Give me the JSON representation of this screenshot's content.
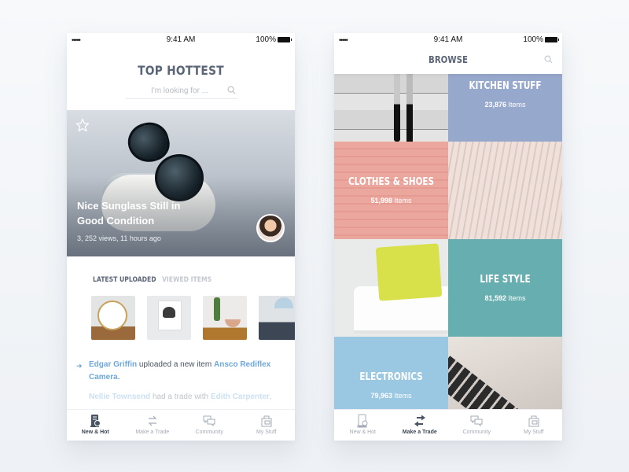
{
  "status_bar": {
    "signal": "•••••",
    "time": "9:41 AM",
    "battery": "100%"
  },
  "left_screen": {
    "title": "TOP HOTTEST",
    "search": {
      "placeholder": "I'm looking for ..."
    },
    "hero": {
      "title": "Nice Sunglass Still in Good Condition",
      "meta": "3, 252 views, 11 hours ago"
    },
    "tabs": [
      {
        "label": "LATEST UPLOADED",
        "active": true
      },
      {
        "label": "VIEWED ITEMS",
        "active": false
      }
    ],
    "thumbnails": [
      "wall-clock",
      "xo-heart-poster",
      "cactus-plants",
      "desk-lamp"
    ],
    "feed": [
      {
        "user": "Edgar Griffin",
        "action": "uploaded a new item",
        "target": "Ansco Rediflex Camera",
        "suffix": "."
      },
      {
        "user": "Nellie Townsend",
        "action": "had a trade with",
        "target": "Edith Carpenter",
        "suffix": "."
      }
    ]
  },
  "right_screen": {
    "title": "BROWSE",
    "categories": [
      {
        "name": "KITCHEN STUFF",
        "count": "23,876",
        "unit": "Items",
        "color": "#97a8cd"
      },
      {
        "name": "CLOTHES & SHOES",
        "count": "51,998",
        "unit": "Items",
        "color": "#eba79e"
      },
      {
        "name": "LIFE STYLE",
        "count": "81,592",
        "unit": "Items",
        "color": "#66aeb0"
      },
      {
        "name": "ELECTRONICS",
        "count": "79,963",
        "unit": "Items",
        "color": "#9ac7e1"
      }
    ]
  },
  "nav": {
    "items": [
      {
        "label": "New & Hot",
        "icon": "new-hot-icon"
      },
      {
        "label": "Make a Trade",
        "icon": "trade-arrows-icon"
      },
      {
        "label": "Community",
        "icon": "chat-bubbles-icon"
      },
      {
        "label": "My Stuff",
        "icon": "bag-icon"
      }
    ],
    "left_active": "New & Hot",
    "right_active": "Make a Trade"
  },
  "colors": {
    "title": "#5a6577",
    "link": "#6ea7de",
    "nav_inactive": "#a4abb6"
  }
}
